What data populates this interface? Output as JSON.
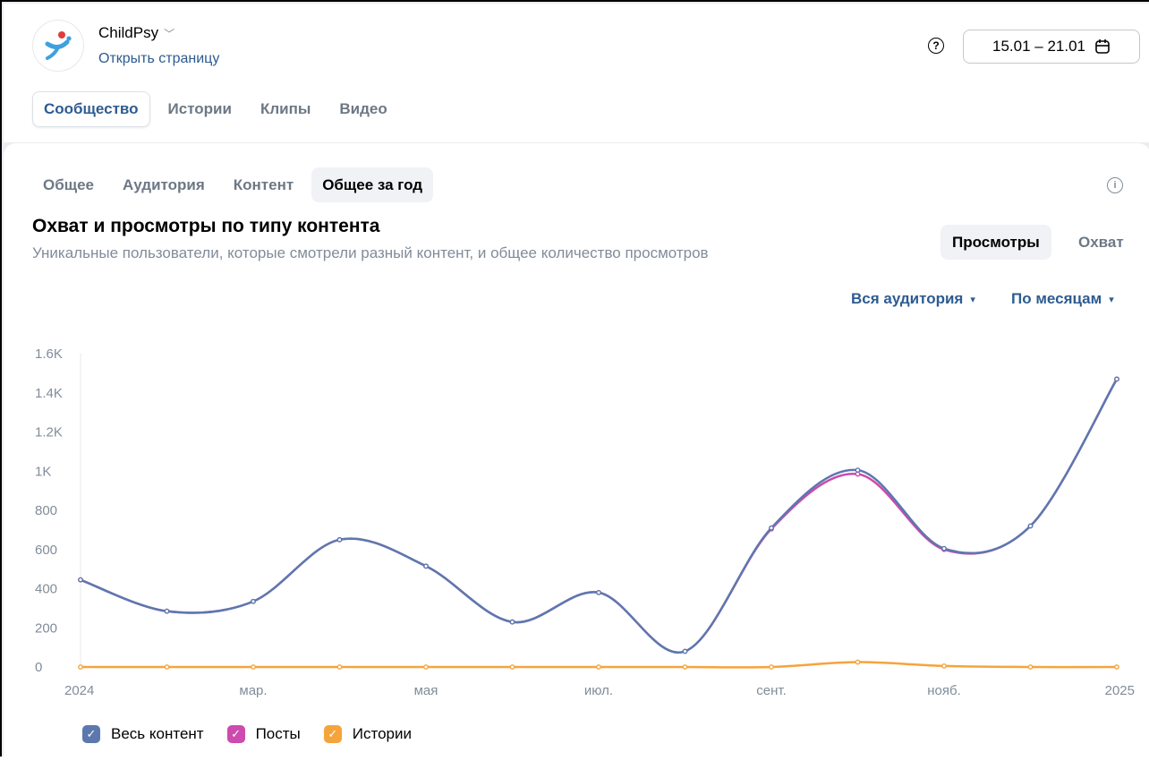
{
  "header": {
    "group_name": "ChildPsy",
    "open_page": "Открыть страницу",
    "date_range": "15.01 – 21.01"
  },
  "top_tabs": [
    {
      "label": "Сообщество",
      "active": true
    },
    {
      "label": "Истории",
      "active": false
    },
    {
      "label": "Клипы",
      "active": false
    },
    {
      "label": "Видео",
      "active": false
    }
  ],
  "sub_tabs": [
    {
      "label": "Общее",
      "active": false
    },
    {
      "label": "Аудитория",
      "active": false
    },
    {
      "label": "Контент",
      "active": false
    },
    {
      "label": "Общее за год",
      "active": true
    }
  ],
  "section": {
    "title": "Охват и просмотры по типу контента",
    "subtitle": "Уникальные пользователи, которые смотрели разный контент, и общее количество просмотров",
    "segment_active": "Просмотры",
    "segment_inactive": "Охват",
    "filter_audience": "Вся аудитория",
    "filter_period": "По месяцам"
  },
  "colors": {
    "all_content": "#5c78ae",
    "posts": "#cd4aae",
    "stories": "#f5a43c",
    "link": "#2d5b91"
  },
  "chart_data": {
    "type": "line",
    "x": [
      "2024-01",
      "2024-02",
      "2024-03",
      "2024-04",
      "2024-05",
      "2024-06",
      "2024-07",
      "2024-08",
      "2024-09",
      "2024-10",
      "2024-11",
      "2024-12",
      "2025-01"
    ],
    "x_tick_labels": [
      "2024",
      "мар.",
      "мая",
      "июл.",
      "сент.",
      "нояб.",
      "2025"
    ],
    "y_tick_labels": [
      "0",
      "200",
      "400",
      "600",
      "800",
      "1K",
      "1.2K",
      "1.4K",
      "1.6K"
    ],
    "ylim": [
      0,
      1600
    ],
    "series": [
      {
        "name": "Весь контент",
        "color": "#5c78ae",
        "values": [
          445,
          285,
          335,
          650,
          515,
          230,
          380,
          80,
          710,
          1005,
          605,
          720,
          1470
        ]
      },
      {
        "name": "Посты",
        "color": "#cd4aae",
        "values": [
          445,
          285,
          335,
          650,
          515,
          230,
          380,
          80,
          705,
          985,
          600,
          720,
          1470
        ]
      },
      {
        "name": "Истории",
        "color": "#f5a43c",
        "values": [
          0,
          0,
          0,
          0,
          0,
          0,
          0,
          0,
          0,
          25,
          5,
          0,
          0
        ]
      }
    ],
    "legend": [
      "Весь контент",
      "Посты",
      "Истории"
    ],
    "legend_position": "bottom-left",
    "grid": false
  }
}
